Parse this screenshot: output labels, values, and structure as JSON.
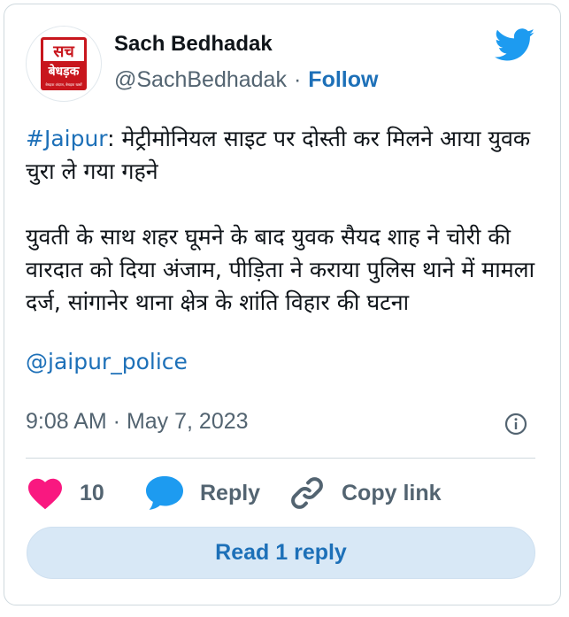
{
  "author": {
    "name": "Sach Bedhadak",
    "handle": "@SachBedhadak",
    "separator": "·",
    "follow_label": "Follow",
    "avatar": {
      "logo_text": "सच",
      "logo_subtext": "बेधड़क",
      "tagline": "बेधड़क अंदाज, बेधड़क खबरें",
      "brand_color": "#c8161d"
    }
  },
  "tweet": {
    "hashtag": "#Jaipur",
    "line1_rest": ": मेट्रीमोनियल साइट पर दोस्ती कर मिलने आया युवक चुरा ले गया गहने",
    "paragraph2": "युवती के साथ शहर घूमने के बाद युवक सैयद शाह ने चोरी की वारदात को दिया अंजाम, पीड़िता ने कराया पुलिस थाने में मामला दर्ज, सांगानेर थाना क्षेत्र के शांति विहार की घटना",
    "mention": "@jaipur_police"
  },
  "timestamp": "9:08 AM · May 7, 2023",
  "actions": {
    "like_count": "10",
    "reply_label": "Reply",
    "copy_link_label": "Copy link"
  },
  "read_reply_label": "Read 1 reply",
  "colors": {
    "link": "#1d70b8",
    "heart": "#f91880",
    "reply_bubble": "#1d9bf0",
    "twitter_blue": "#1d9bf0",
    "button_bg": "#d8e8f6"
  },
  "icons": {
    "brand": "twitter-bird-icon",
    "info": "info-icon",
    "like": "heart-icon",
    "reply": "speech-bubble-icon",
    "copy": "link-chain-icon"
  }
}
